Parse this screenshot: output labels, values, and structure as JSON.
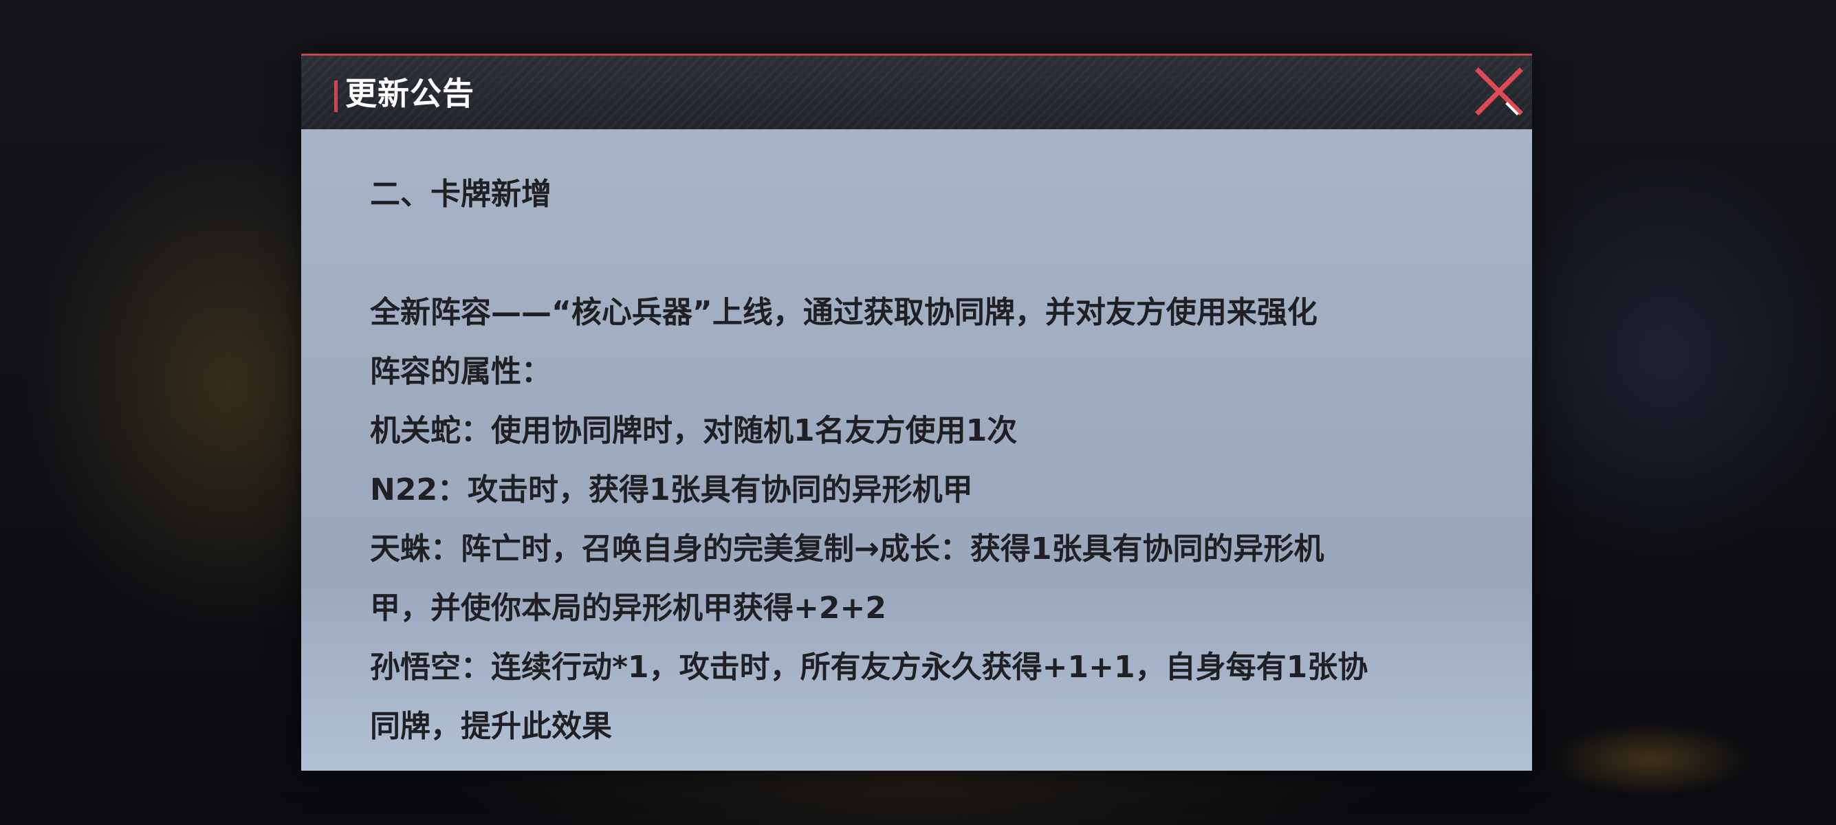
{
  "dialog": {
    "title": "更新公告",
    "close_icon": "close-x-icon",
    "accent_color": "#d6454c"
  },
  "content": {
    "heading": "二、卡牌新增",
    "lines": [
      "全新阵容——“核心兵器”上线，通过获取协同牌，并对友方使用来强化",
      "阵容的属性：",
      "机关蛇：使用协同牌时，对随机1名友方使用1次",
      "N22：攻击时，获得1张具有协同的异形机甲",
      "天蛛：阵亡时，召唤自身的完美复制→成长：获得1张具有协同的异形机",
      "甲，并使你本局的异形机甲获得+2+2",
      "孙悟空：连续行动*1，攻击时，所有友方永久获得+1+1，自身每有1张协",
      "同牌，提升此效果"
    ]
  }
}
